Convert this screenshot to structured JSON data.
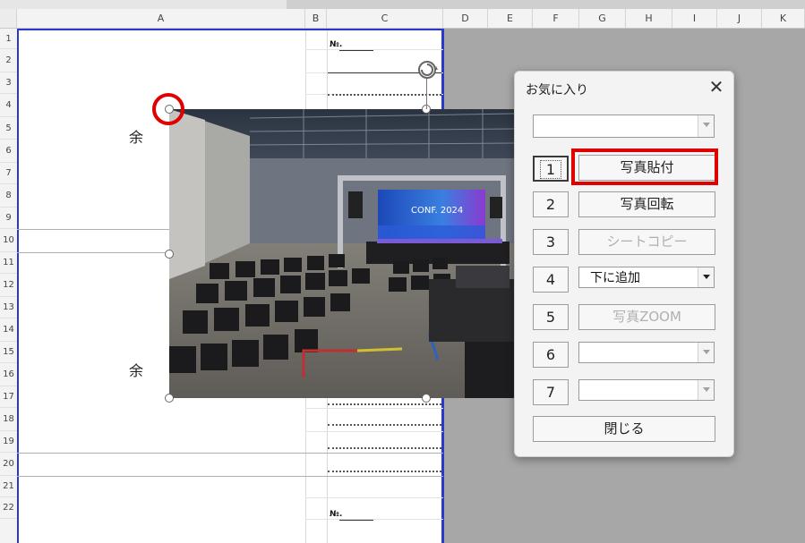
{
  "sheet": {
    "columns": [
      "A",
      "B",
      "C",
      "D",
      "E",
      "F",
      "G",
      "H",
      "I",
      "J",
      "K"
    ],
    "rows": [
      "1",
      "2",
      "3",
      "4",
      "5",
      "6",
      "7",
      "8",
      "9",
      "10",
      "11",
      "12",
      "13",
      "14",
      "15",
      "16",
      "17",
      "18",
      "19",
      "20",
      "21",
      "22"
    ],
    "cells": {
      "a5": "余",
      "a15": "余",
      "no1": "№.",
      "no21": "№."
    }
  },
  "dialog": {
    "title": "お気に入り",
    "close_icon": "close-icon",
    "top_combo_value": "",
    "rows": [
      {
        "num": "1",
        "label": "写真貼付",
        "type": "button",
        "enabled": true
      },
      {
        "num": "2",
        "label": "写真回転",
        "type": "button",
        "enabled": true
      },
      {
        "num": "3",
        "label": "シートコピー",
        "type": "button",
        "enabled": false
      },
      {
        "num": "4",
        "label": "下に追加",
        "type": "combo",
        "enabled": true
      },
      {
        "num": "5",
        "label": "写真ZOOM",
        "type": "button",
        "enabled": false
      },
      {
        "num": "6",
        "label": "",
        "type": "combo",
        "enabled": false
      },
      {
        "num": "7",
        "label": "",
        "type": "combo",
        "enabled": false
      }
    ],
    "close_button": "閉じる"
  },
  "photo": {
    "screen_text": "CONF. 2024"
  },
  "colors": {
    "highlight": "#e00000",
    "print_border": "#2a39c9"
  }
}
